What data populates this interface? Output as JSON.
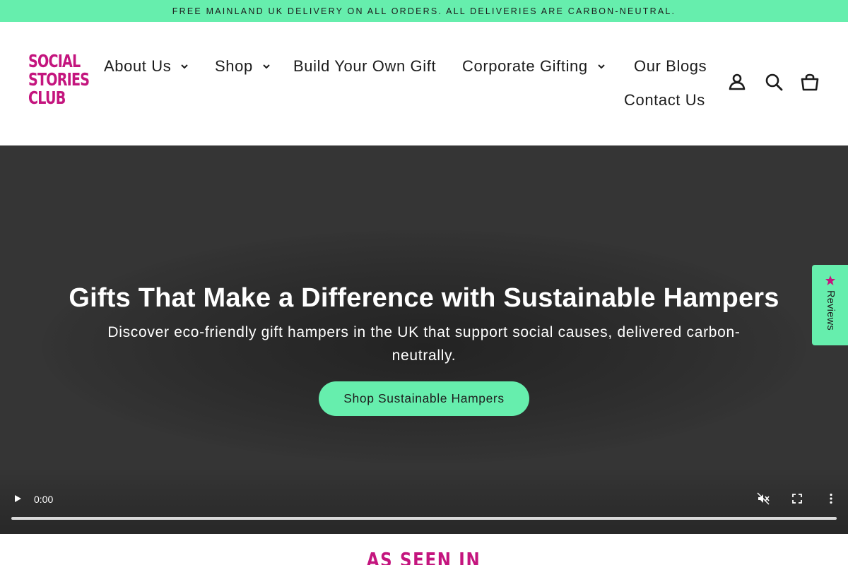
{
  "announcement": "FREE MAINLAND UK DELIVERY ON ALL ORDERS. ALL DELIVERIES ARE CARBON-NEUTRAL.",
  "logo": {
    "line1": "SOCIAL",
    "line2": "STORIES",
    "line3": "CLUB",
    "color": "#c4157e"
  },
  "nav": {
    "items": [
      {
        "label": "About Us",
        "has_dropdown": true
      },
      {
        "label": "Shop",
        "has_dropdown": true
      },
      {
        "label": "Build Your Own Gift",
        "has_dropdown": false
      },
      {
        "label": "Corporate Gifting",
        "has_dropdown": true
      },
      {
        "label": "Our Blogs",
        "has_dropdown": false
      },
      {
        "label": "Contact Us",
        "has_dropdown": false
      }
    ],
    "icons": [
      "account-icon",
      "search-icon",
      "cart-icon"
    ]
  },
  "hero": {
    "title": "Gifts That Make a Difference with Sustainable Hampers",
    "subtitle": "Discover eco-friendly gift hampers in the UK that support social causes, delivered carbon-neutrally.",
    "cta": "Shop Sustainable Hampers",
    "video_time": "0:00",
    "video_progress": 0
  },
  "reviews_tab": {
    "label": "Reviews"
  },
  "as_seen_in": "AS SEEN IN",
  "colors": {
    "accent": "#66eead",
    "brand": "#c4157e",
    "hero_bg": "#353535"
  }
}
